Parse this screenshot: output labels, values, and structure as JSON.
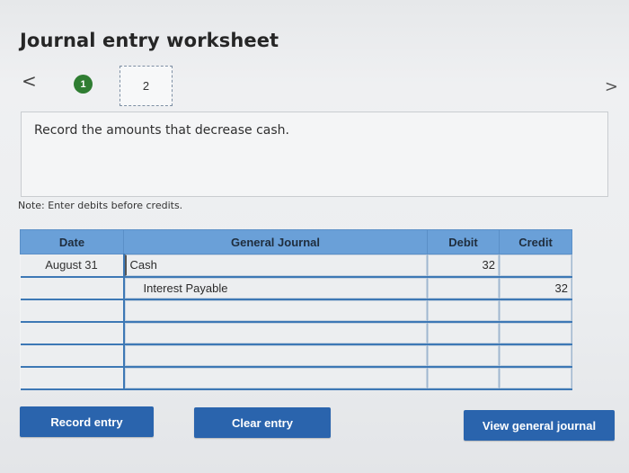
{
  "header": {
    "title": "Journal entry worksheet",
    "prev_icon": "<",
    "next_icon": ">",
    "steps": [
      "1",
      "2"
    ]
  },
  "instruction": "Record the amounts that decrease cash.",
  "note": "Note: Enter debits before credits.",
  "table": {
    "headers": {
      "date": "Date",
      "journal": "General Journal",
      "debit": "Debit",
      "credit": "Credit"
    },
    "rows": [
      {
        "date": "August 31",
        "account": "Cash",
        "debit": "32",
        "credit": ""
      },
      {
        "date": "",
        "account": "Interest Payable",
        "debit": "",
        "credit": "32"
      },
      {
        "date": "",
        "account": "",
        "debit": "",
        "credit": ""
      },
      {
        "date": "",
        "account": "",
        "debit": "",
        "credit": ""
      },
      {
        "date": "",
        "account": "",
        "debit": "",
        "credit": ""
      },
      {
        "date": "",
        "account": "",
        "debit": "",
        "credit": ""
      }
    ]
  },
  "buttons": {
    "record": "Record entry",
    "clear": "Clear entry",
    "view": "View general journal"
  },
  "colors": {
    "header_blue": "#6aa0d8",
    "button_blue": "#2a64ad",
    "step_green": "#2f7d32"
  }
}
